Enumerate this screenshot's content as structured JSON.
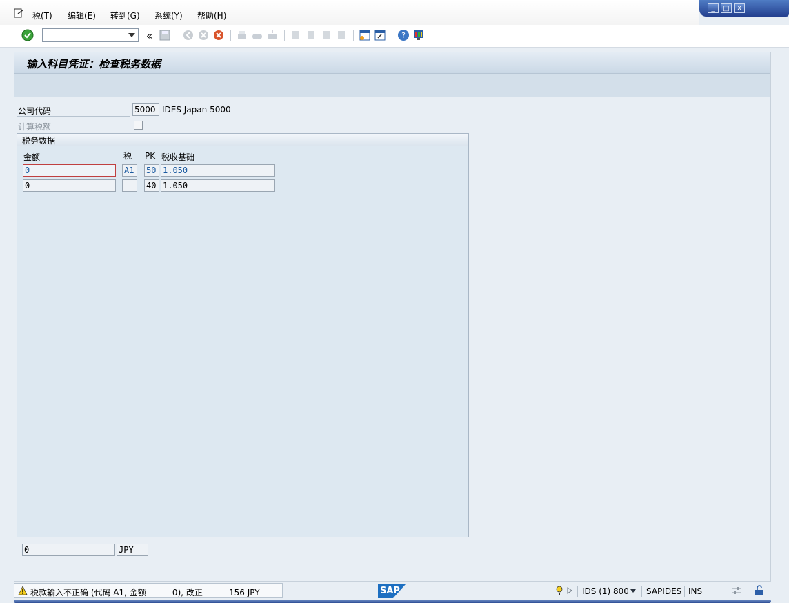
{
  "window": {
    "minimize_label": "_",
    "maximize_label": "□",
    "close_label": "X"
  },
  "menu": {
    "items": [
      "税(T)",
      "编辑(E)",
      "转到(G)",
      "系统(Y)",
      "帮助(H)"
    ]
  },
  "toolbar": {
    "command_field_value": "",
    "back_label": "«"
  },
  "screen": {
    "title": "输入科目凭证：检查税务数据"
  },
  "header_fields": {
    "company_code_label": "公司代码",
    "company_code_value": "5000",
    "company_name": "IDES Japan 5000",
    "calc_tax_label": "计算税额",
    "calc_tax_checked": false
  },
  "tax_group": {
    "title": "税务数据",
    "columns": {
      "amount": "金额",
      "tax": "税",
      "pk": "PK",
      "base": "税收基础"
    },
    "rows": [
      {
        "amount": "0",
        "tax": "A1",
        "pk": "50",
        "base": "1.050"
      },
      {
        "amount": "0",
        "tax": "",
        "pk": "40",
        "base": "1.050"
      }
    ]
  },
  "totals": {
    "amount": "0",
    "currency": "JPY"
  },
  "status": {
    "message": "税款输入不正确 (代码 A1, 金额          0), 改正          156 JPY",
    "logo": "SAP",
    "system": "IDS (1) 800",
    "server": "SAPIDES",
    "mode": "INS"
  },
  "colors": {
    "accent": "#1a5aa0",
    "status_warning": "#e0b000",
    "sap_logo": "#1d6fc1"
  }
}
